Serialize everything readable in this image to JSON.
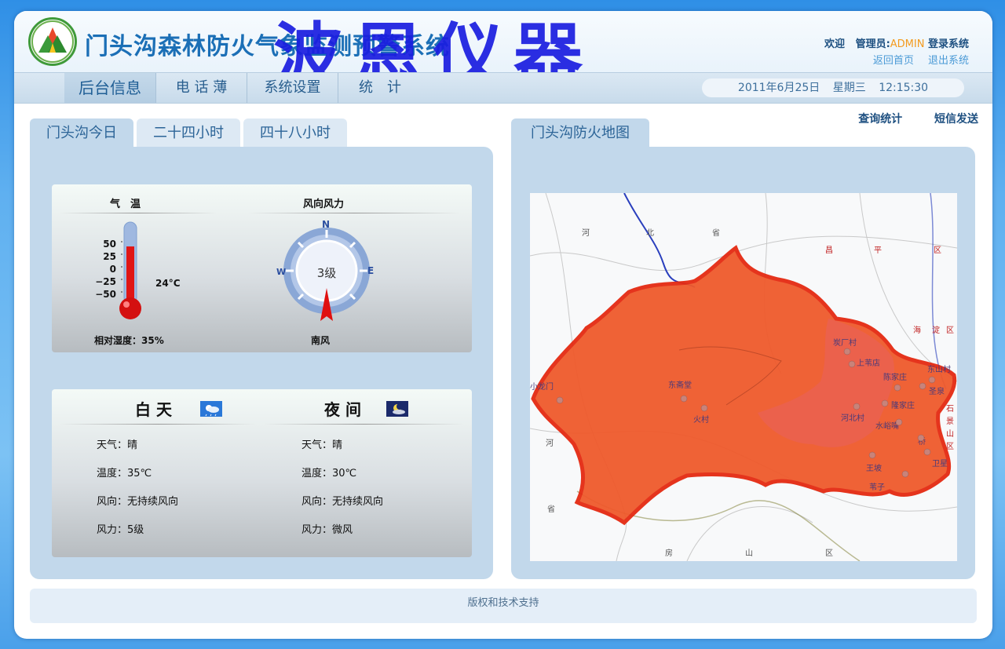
{
  "header": {
    "app_title": "门头沟森林防火气象监测预警系统",
    "watermark": "波恩仪器",
    "welcome": "欢迎",
    "role_prefix": "管理员:",
    "username": "ADMIN",
    "login_suffix": "登录系统",
    "home_link": "返回首页",
    "logout_link": "退出系统"
  },
  "nav": {
    "items": [
      {
        "label": "后台信息"
      },
      {
        "label": "电 话 薄"
      },
      {
        "label": "系统设置"
      },
      {
        "label": "统　计"
      }
    ],
    "date": "2011年6月25日",
    "weekday": "星期三",
    "time": "12:15:30"
  },
  "top_links": [
    "查询统计",
    "短信发送"
  ],
  "left_tabs": [
    "门头沟今日",
    "二十四小时",
    "四十八小时"
  ],
  "right_tab": "门头沟防火地图",
  "temperature": {
    "title": "气　温",
    "scale": [
      "50",
      "25",
      "0",
      "−25",
      "−50"
    ],
    "value": "24°C",
    "level_fraction": 0.74,
    "humidity": "相对湿度：35%"
  },
  "wind": {
    "title": "风向风力",
    "n": "N",
    "e": "E",
    "w": "W",
    "level": "3级",
    "direction": "南风"
  },
  "day": {
    "title": "白 天",
    "weather": "天气：晴",
    "temp": "温度：35℃",
    "wind_dir": "风向：无持续风向",
    "wind_force": "风力：5级"
  },
  "night": {
    "title": "夜 间",
    "weather": "天气：晴",
    "temp": "温度：30℃",
    "wind_dir": "风向：无持续风向",
    "wind_force": "风力：微风"
  },
  "map": {
    "labels": [
      "小龙门",
      "东斋堂",
      "火村",
      "炭厂村",
      "上苇店",
      "陈家庄",
      "河北村",
      "隆家庄",
      "水峪嘴",
      "王坡",
      "卫星",
      "苇子",
      "桥",
      "圣泉",
      "东山村"
    ],
    "background_letters": [
      "河",
      "北",
      "省",
      "昌",
      "平",
      "区",
      "海",
      "淀",
      "区",
      "石",
      "景",
      "山",
      "区",
      "房",
      "山",
      "区",
      "河",
      "省"
    ]
  },
  "footer": "版权和技术支持",
  "colors": {
    "brand_blue": "#1b6fb6",
    "admin_orange": "#f39a1d",
    "map_red": "#ef3b1c",
    "panel": "#c2d8eb"
  }
}
